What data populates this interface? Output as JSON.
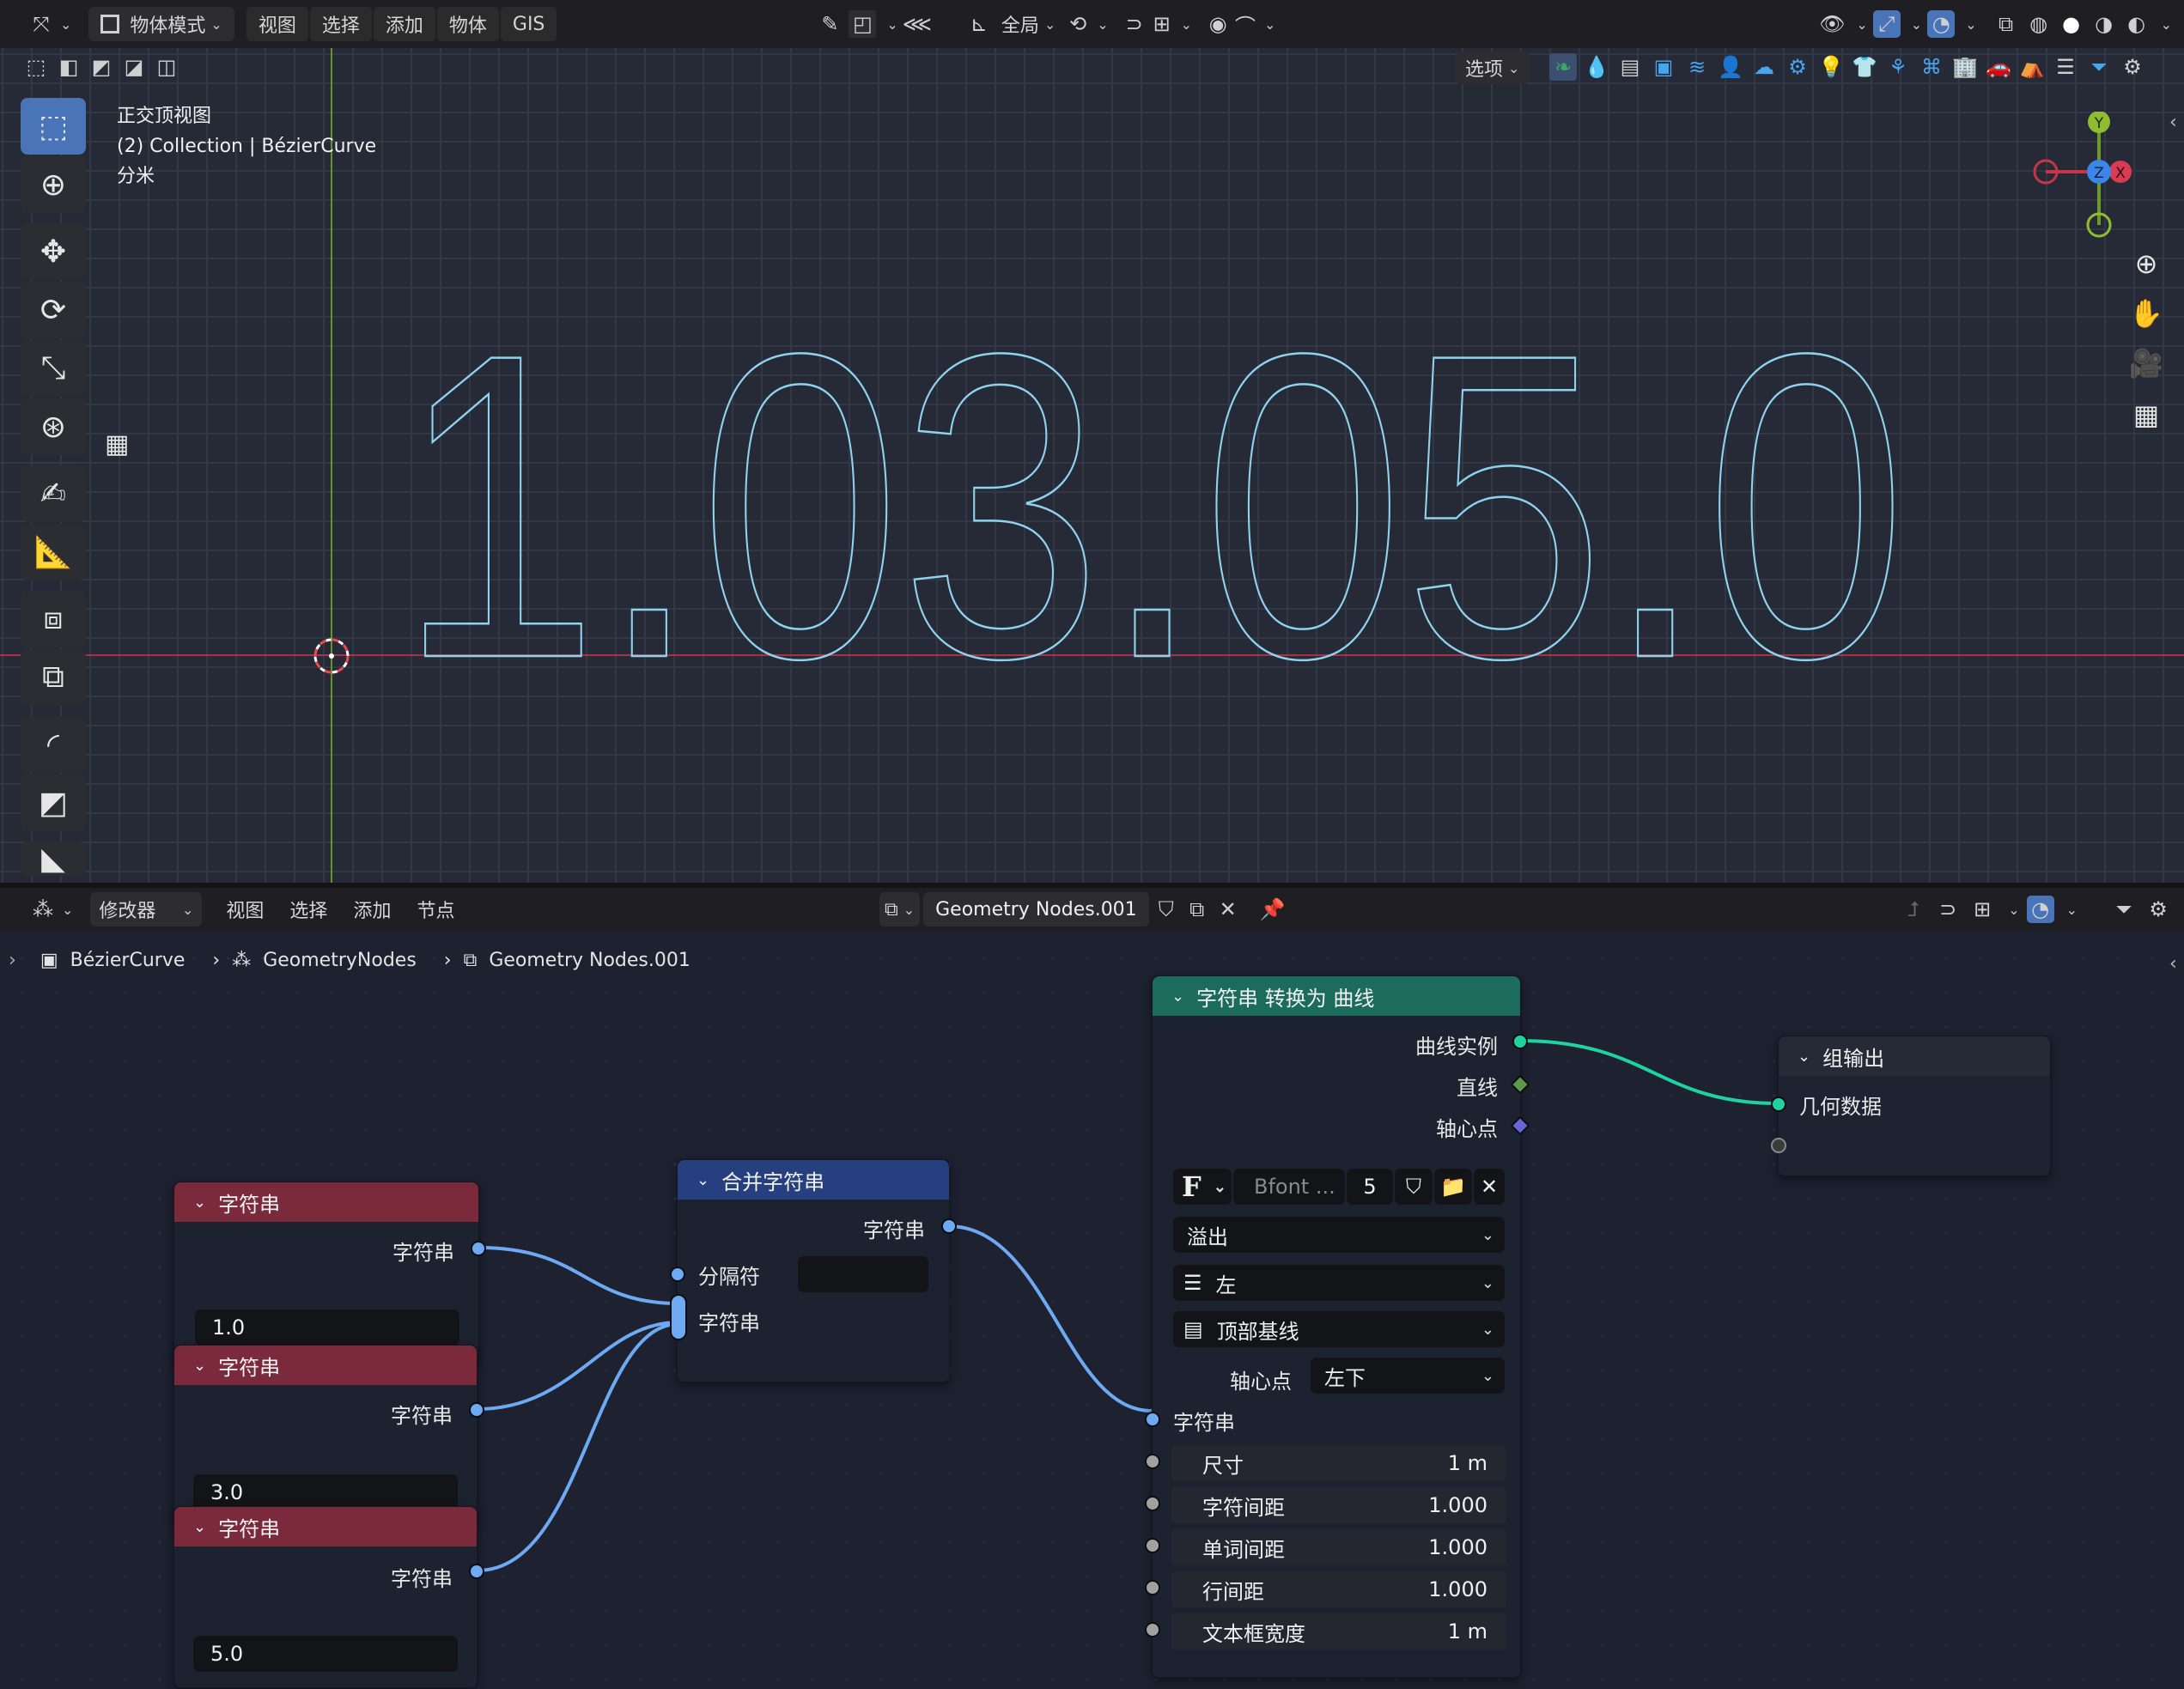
{
  "viewport": {
    "header": {
      "mode_label": "物体模式",
      "menus": [
        "视图",
        "选择",
        "添加",
        "物体",
        "GIS"
      ],
      "transform_orientation": "全局",
      "options_label": "选项"
    },
    "info": {
      "view_name": "正交顶视图",
      "collection_line": "(2) Collection | BézierCurve",
      "units": "分米"
    },
    "text_object": "1.03.05.0",
    "gizmo": {
      "y": "Y",
      "z": "Z",
      "x": "X"
    }
  },
  "node_editor": {
    "header": {
      "editor_type": "修改器",
      "menus": [
        "视图",
        "选择",
        "添加",
        "节点"
      ],
      "node_tree_name": "Geometry Nodes.001"
    },
    "breadcrumb": [
      "BézierCurve",
      "GeometryNodes",
      "Geometry Nodes.001"
    ],
    "nodes": {
      "string1": {
        "title": "字符串",
        "output": "字符串",
        "value": "1.0"
      },
      "string2": {
        "title": "字符串",
        "output": "字符串",
        "value": "3.0"
      },
      "string3": {
        "title": "字符串",
        "output": "字符串",
        "value": "5.0"
      },
      "join": {
        "title": "合并字符串",
        "output": "字符串",
        "delimiter": "分隔符",
        "strings": "字符串"
      },
      "to_curves": {
        "title": "字符串 转换为 曲线",
        "outputs": [
          "曲线实例",
          "直线",
          "轴心点"
        ],
        "font_name": "Bfont ...",
        "font_users": "5",
        "overflow": "溢出",
        "align_x": "左",
        "align_y": "顶部基线",
        "pivot_label": "轴心点",
        "pivot_value": "左下",
        "string_input": "字符串",
        "fields": [
          {
            "label": "尺寸",
            "value": "1 m"
          },
          {
            "label": "字符间距",
            "value": "1.000"
          },
          {
            "label": "单词间距",
            "value": "1.000"
          },
          {
            "label": "行间距",
            "value": "1.000"
          },
          {
            "label": "文本框宽度",
            "value": "1 m"
          }
        ]
      },
      "group_output": {
        "title": "组输出",
        "input": "几何数据"
      }
    }
  },
  "colors": {
    "string_node_header": "#7b2a3b",
    "join_node_header": "#263f7e",
    "to_curves_header": "#1c6c5e",
    "group_output_header": "#262a36",
    "string_socket": "#6eaaf3",
    "geometry_socket": "#1ed3a0",
    "text_outline": "#8fd3ee",
    "x_axis": "#c7344a",
    "y_axis": "#6d9b2b"
  }
}
